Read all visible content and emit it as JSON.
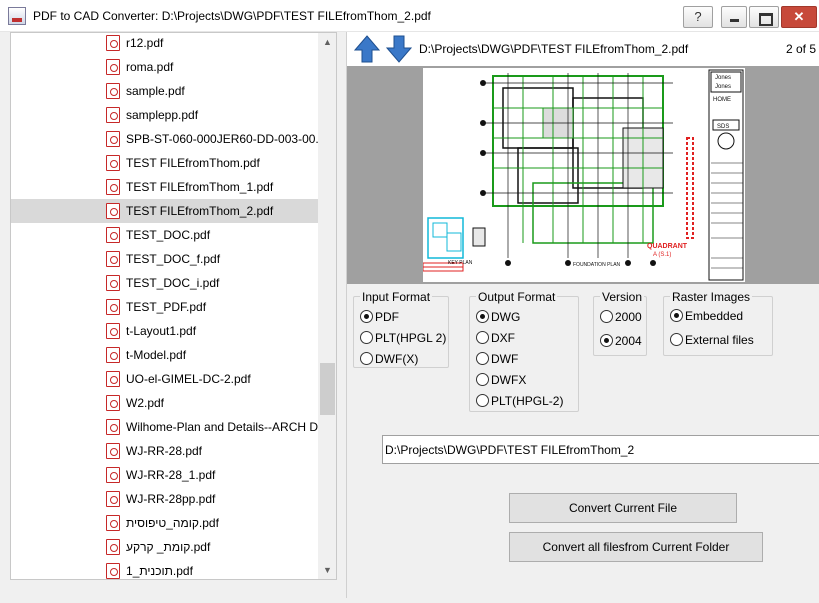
{
  "window": {
    "title": "PDF to CAD Converter: D:\\Projects\\DWG\\PDF\\TEST FILEfromThom_2.pdf",
    "help_label": "?",
    "close_label": "✕"
  },
  "files": [
    "r12.pdf",
    "roma.pdf",
    "sample.pdf",
    "samplepp.pdf",
    "SPB-ST-060-000JER60-DD-003-00.pdf",
    "TEST FILEfromThom.pdf",
    "TEST FILEfromThom_1.pdf",
    "TEST FILEfromThom_2.pdf",
    "TEST_DOC.pdf",
    "TEST_DOC_f.pdf",
    "TEST_DOC_i.pdf",
    "TEST_PDF.pdf",
    "t-Layout1.pdf",
    "t-Model.pdf",
    "UO-el-GIMEL-DC-2.pdf",
    "W2.pdf",
    "Wilhome-Plan and Details--ARCH D",
    "WJ-RR-28.pdf",
    "WJ-RR-28_1.pdf",
    "WJ-RR-28pp.pdf",
    "קומה_טיפוסית.pdf",
    "קומת_ קרקע.pdf",
    "תוכנית_1.pdf"
  ],
  "selected_file_index": 7,
  "viewer": {
    "path": "D:\\Projects\\DWG\\PDF\\TEST FILEfromThom_2.pdf",
    "page_indicator": "2 of 5"
  },
  "input_format": {
    "title": "Input Format",
    "options": [
      "PDF",
      "PLT(HPGL 2)",
      "DWF(X)"
    ],
    "selected": "PDF"
  },
  "output_format": {
    "title": "Output Format",
    "options": [
      "DWG",
      "DXF",
      "DWF",
      "DWFX",
      "PLT(HPGL-2)"
    ],
    "selected": "DWG"
  },
  "version": {
    "title": "Version",
    "options": [
      "2000",
      "2004"
    ],
    "selected": "2004"
  },
  "raster_images": {
    "title": "Raster Images",
    "options": [
      "Embedded",
      "External files"
    ],
    "selected": "Embedded"
  },
  "output_path": "D:\\Projects\\DWG\\PDF\\TEST FILEfromThom_2",
  "buttons": {
    "convert_current": "Convert Current File",
    "convert_all": "Convert all filesfrom Current Folder"
  },
  "drawing_text": {
    "firm_top": "Jones",
    "firm_sub": "Jones",
    "logo": "HOME",
    "sheet_code": "SDS",
    "quadrant": "QUADRANT",
    "quadrant_sub": "A (S.1)",
    "plan_title": "FOUNDATION PLAN",
    "key_plan": "KEY PLAN"
  },
  "colors": {
    "arrow_blue": "#3a78c8",
    "drawing_green": "#1a9a1a",
    "drawing_red": "#e02020",
    "drawing_cyan": "#10b8d8"
  }
}
